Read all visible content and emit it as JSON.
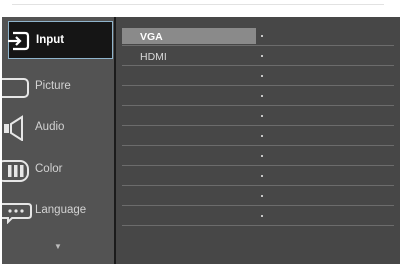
{
  "osd": {
    "menu": [
      {
        "label": "Input",
        "icon": "input-icon",
        "active": true
      },
      {
        "label": "Picture",
        "icon": "picture-icon",
        "active": false
      },
      {
        "label": "Audio",
        "icon": "audio-icon",
        "active": false
      },
      {
        "label": "Color",
        "icon": "color-icon",
        "active": false
      },
      {
        "label": "Language",
        "icon": "language-icon",
        "active": false
      }
    ],
    "more_icon": "chevron-down-icon",
    "options": [
      {
        "label": "VGA",
        "selected": true
      },
      {
        "label": "HDMI",
        "selected": false
      },
      {
        "label": "",
        "selected": false
      },
      {
        "label": "",
        "selected": false
      },
      {
        "label": "",
        "selected": false
      },
      {
        "label": "",
        "selected": false
      },
      {
        "label": "",
        "selected": false
      },
      {
        "label": "",
        "selected": false
      },
      {
        "label": "",
        "selected": false
      },
      {
        "label": "",
        "selected": false
      }
    ],
    "colors": {
      "accent_border": "#8fb4cc",
      "selected_bar": "#8a8a8a"
    }
  }
}
